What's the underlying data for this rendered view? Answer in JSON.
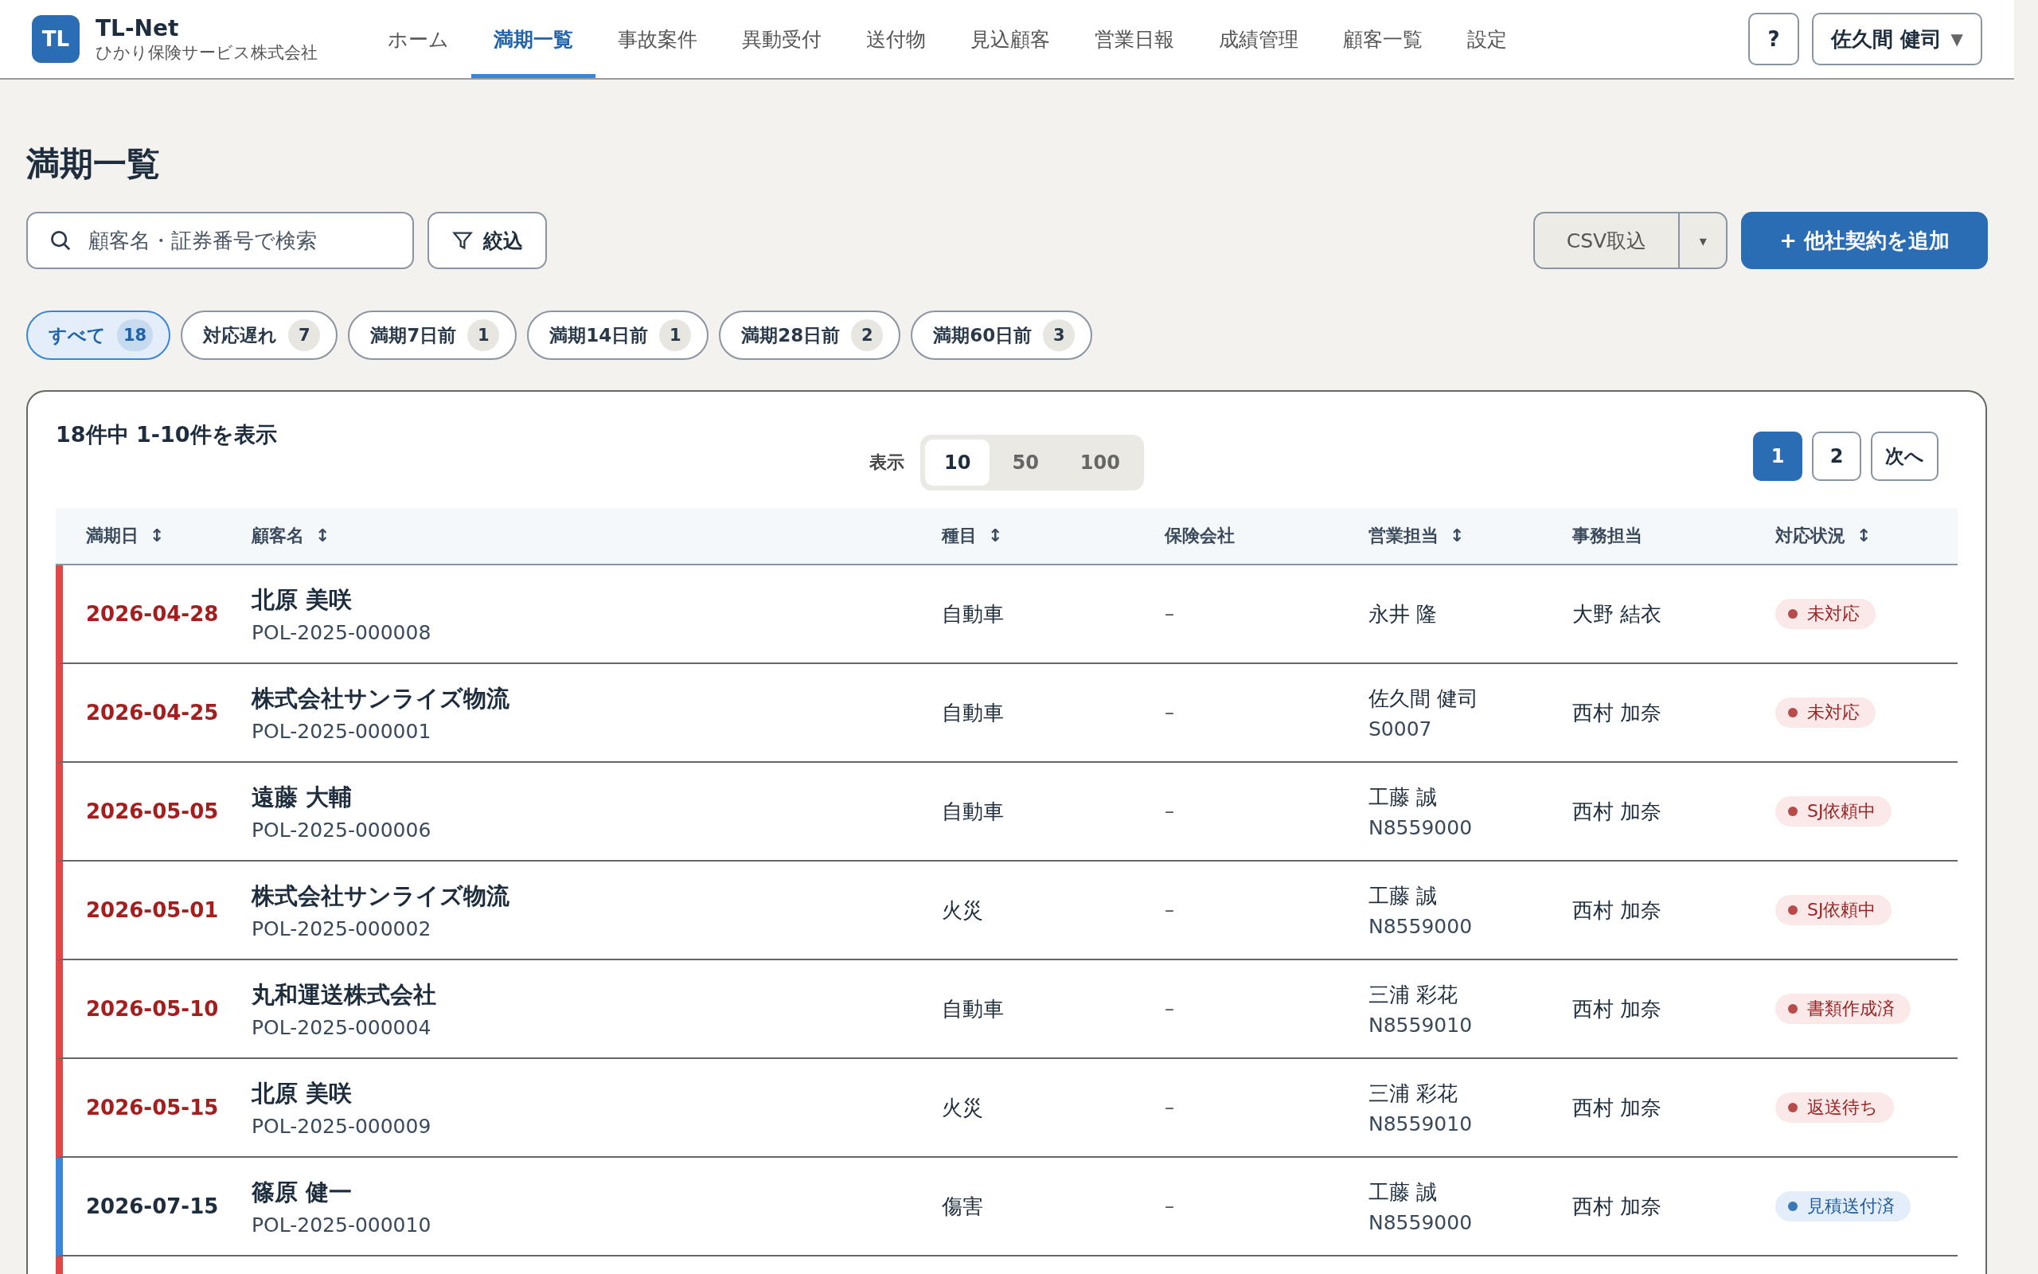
{
  "brand": {
    "logo": "TL",
    "name": "TL-Net",
    "company": "ひかり保険サービス株式会社"
  },
  "nav": [
    {
      "label": "ホーム",
      "selected": false
    },
    {
      "label": "満期一覧",
      "selected": true
    },
    {
      "label": "事故案件",
      "selected": false
    },
    {
      "label": "異動受付",
      "selected": false
    },
    {
      "label": "送付物",
      "selected": false
    },
    {
      "label": "見込顧客",
      "selected": false
    },
    {
      "label": "営業日報",
      "selected": false
    },
    {
      "label": "成績管理",
      "selected": false
    },
    {
      "label": "顧客一覧",
      "selected": false
    },
    {
      "label": "設定",
      "selected": false
    }
  ],
  "help_button": "?",
  "user_menu": {
    "name": "佐久間 健司",
    "caret": "▼"
  },
  "page_title": "満期一覧",
  "search": {
    "placeholder": "顧客名・証券番号で検索"
  },
  "filter_button": "絞込",
  "csv_button": "CSV取込",
  "csv_caret": "▾",
  "add_button": "+ 他社契約を追加",
  "chips": [
    {
      "label": "すべて",
      "count": "18",
      "selected": true
    },
    {
      "label": "対応遅れ",
      "count": "7",
      "selected": false
    },
    {
      "label": "満期7日前",
      "count": "1",
      "selected": false
    },
    {
      "label": "満期14日前",
      "count": "1",
      "selected": false
    },
    {
      "label": "満期28日前",
      "count": "2",
      "selected": false
    },
    {
      "label": "満期60日前",
      "count": "3",
      "selected": false
    }
  ],
  "summary": "18件中 1-10件を表示",
  "page_size": {
    "label": "表示",
    "options": [
      {
        "label": "10",
        "selected": true
      },
      {
        "label": "50",
        "selected": false
      },
      {
        "label": "100",
        "selected": false
      }
    ]
  },
  "pagination": {
    "pages": [
      {
        "label": "1",
        "selected": true
      },
      {
        "label": "2",
        "selected": false
      }
    ],
    "next": "次へ"
  },
  "columns": [
    {
      "label": "満期日",
      "sortable": true
    },
    {
      "label": "顧客名",
      "sortable": true
    },
    {
      "label": "種目",
      "sortable": true
    },
    {
      "label": "保険会社",
      "sortable": false
    },
    {
      "label": "営業担当",
      "sortable": true
    },
    {
      "label": "事務担当",
      "sortable": false
    },
    {
      "label": "対応状況",
      "sortable": true
    }
  ],
  "sort_glyph": "↕",
  "rows": [
    {
      "urgent": true,
      "date": "2026-04-28",
      "name": "北原 美咲",
      "policy": "POL-2025-000008",
      "type": "自動車",
      "insurer": "–",
      "sales": "永井 隆",
      "admin": "大野 結衣",
      "status": "未対応",
      "color": "#b94a4a"
    },
    {
      "urgent": true,
      "date": "2026-04-25",
      "name": "株式会社サンライズ物流",
      "policy": "POL-2025-000001",
      "type": "自動車",
      "insurer": "–",
      "sales": "佐久間 健司",
      "sales_code": "S0007",
      "admin": "西村 加奈",
      "status": "未対応",
      "color": "#b94a4a"
    },
    {
      "urgent": true,
      "date": "2026-05-05",
      "name": "遠藤 大輔",
      "policy": "POL-2025-000006",
      "type": "自動車",
      "insurer": "–",
      "sales": "工藤 誠",
      "sales_code": "N8559000",
      "admin": "西村 加奈",
      "status": "SJ依頼中",
      "color": "#b94a4a"
    },
    {
      "urgent": true,
      "date": "2026-05-01",
      "name": "株式会社サンライズ物流",
      "policy": "POL-2025-000002",
      "type": "火災",
      "insurer": "–",
      "sales": "工藤 誠",
      "sales_code": "N8559000",
      "admin": "西村 加奈",
      "status": "SJ依頼中",
      "color": "#b94a4a"
    },
    {
      "urgent": true,
      "date": "2026-05-10",
      "name": "丸和運送株式会社",
      "policy": "POL-2025-000004",
      "type": "自動車",
      "insurer": "–",
      "sales": "三浦 彩花",
      "sales_code": "N8559010",
      "admin": "西村 加奈",
      "status": "書類作成済",
      "color": "#b94a4a"
    },
    {
      "urgent": true,
      "date": "2026-05-15",
      "name": "北原 美咲",
      "policy": "POL-2025-000009",
      "type": "火災",
      "insurer": "–",
      "sales": "三浦 彩花",
      "sales_code": "N8559010",
      "admin": "西村 加奈",
      "status": "返送待ち",
      "color": "#b94a4a"
    },
    {
      "urgent": false,
      "date": "2026-07-15",
      "name": "篠原 健一",
      "policy": "POL-2025-000010",
      "type": "傷害",
      "insurer": "–",
      "sales": "工藤 誠",
      "sales_code": "N8559000",
      "admin": "西村 加奈",
      "status": "見積送付済",
      "color": "#3a78b8"
    },
    {
      "urgent": true
    }
  ]
}
